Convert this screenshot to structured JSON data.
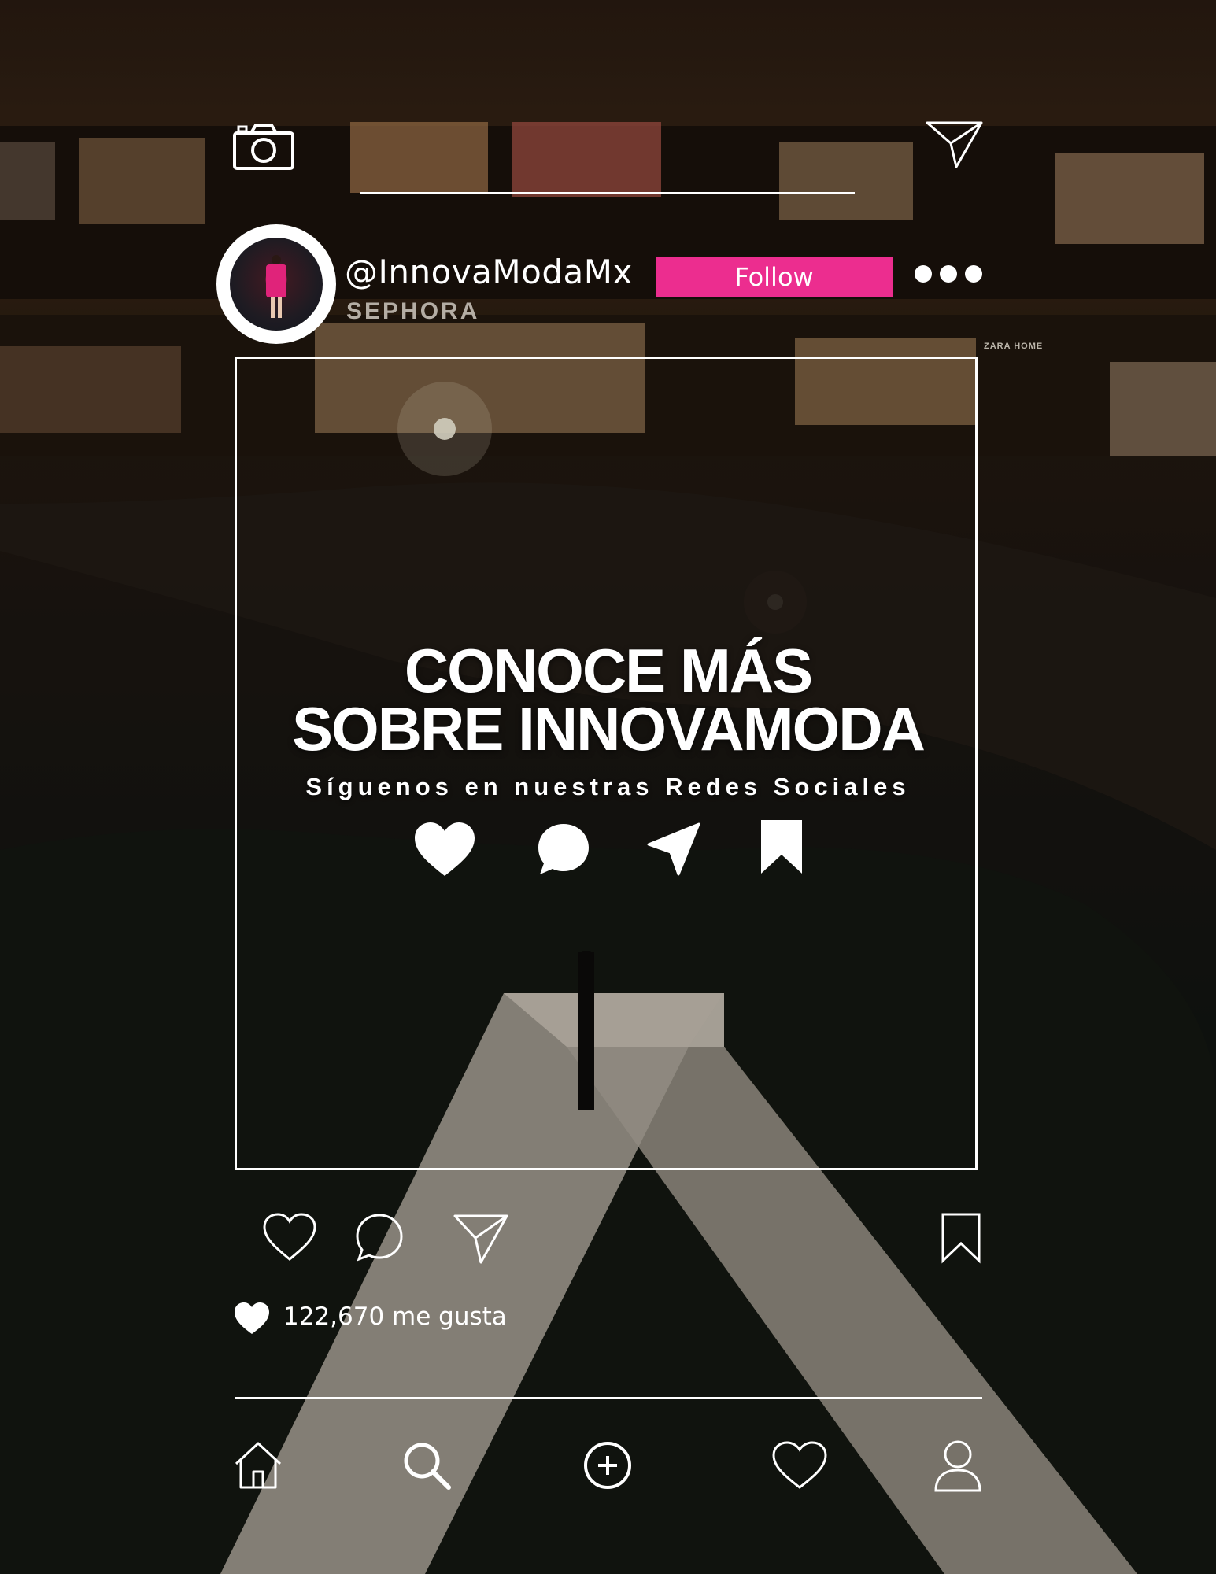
{
  "profile": {
    "username": "@InnovaModaMx",
    "follow_label": "Follow"
  },
  "post": {
    "headline_line1": "CONOCE MÁS",
    "headline_line2": "SOBRE INNOVAMODA",
    "subline": "Síguenos en nuestras Redes Sociales",
    "storefront_sign": "SEPHORA",
    "storefront_sign_2": "ZARA HOME"
  },
  "stats": {
    "likes_text": "122,670 me gusta"
  },
  "icons": {
    "top_left": "camera-icon",
    "top_right": "send-icon",
    "overlay": [
      "heart-icon",
      "comment-icon",
      "send-icon",
      "bookmark-icon"
    ],
    "actions": [
      "heart-icon",
      "comment-icon",
      "send-icon",
      "bookmark-icon"
    ],
    "nav": [
      "home-icon",
      "search-icon",
      "add-icon",
      "heart-icon",
      "profile-icon"
    ]
  },
  "colors": {
    "accent": "#ec2d8f",
    "foreground": "#ffffff"
  }
}
